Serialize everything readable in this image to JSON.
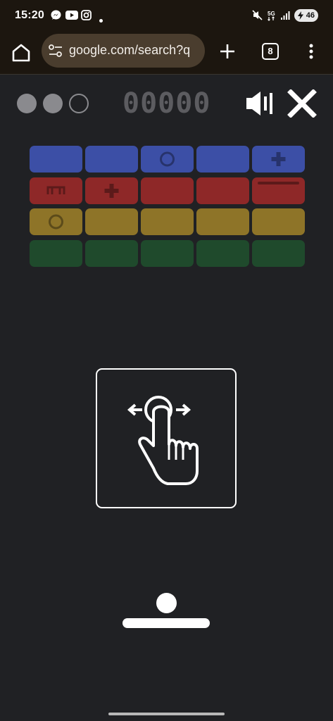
{
  "status_bar": {
    "time": "15:20",
    "notification_icons": [
      "messenger-icon",
      "youtube-icon",
      "instagram-icon",
      "dot-icon"
    ],
    "system_icons": [
      "mute-icon",
      "5g-icon",
      "signal-icon"
    ],
    "battery_level": "46"
  },
  "browser": {
    "url": "google.com/search?q",
    "tab_count": "8"
  },
  "game": {
    "score": "00000",
    "lives": {
      "total": 3,
      "remaining": 2
    },
    "sound": "on",
    "brick_rows": [
      {
        "color": "#3c4fa6",
        "bricks": [
          "",
          "",
          "circle",
          "",
          "plus"
        ]
      },
      {
        "color": "#8e2828",
        "bricks": [
          "barrier",
          "plus",
          "",
          "",
          "dash"
        ]
      },
      {
        "color": "#8e7428",
        "bricks": [
          "circle",
          "",
          "",
          "",
          ""
        ]
      },
      {
        "color": "#1f4a2c",
        "bricks": [
          "",
          "",
          "",
          "",
          ""
        ]
      }
    ],
    "tutorial_hint": "swipe-left-right"
  },
  "colors": {
    "background": "#202124",
    "chrome": "#1c160f",
    "url_bar": "#4a3d2e",
    "score": "#5c5c60",
    "life_full": "#8a8a8e",
    "foreground": "#ffffff"
  }
}
